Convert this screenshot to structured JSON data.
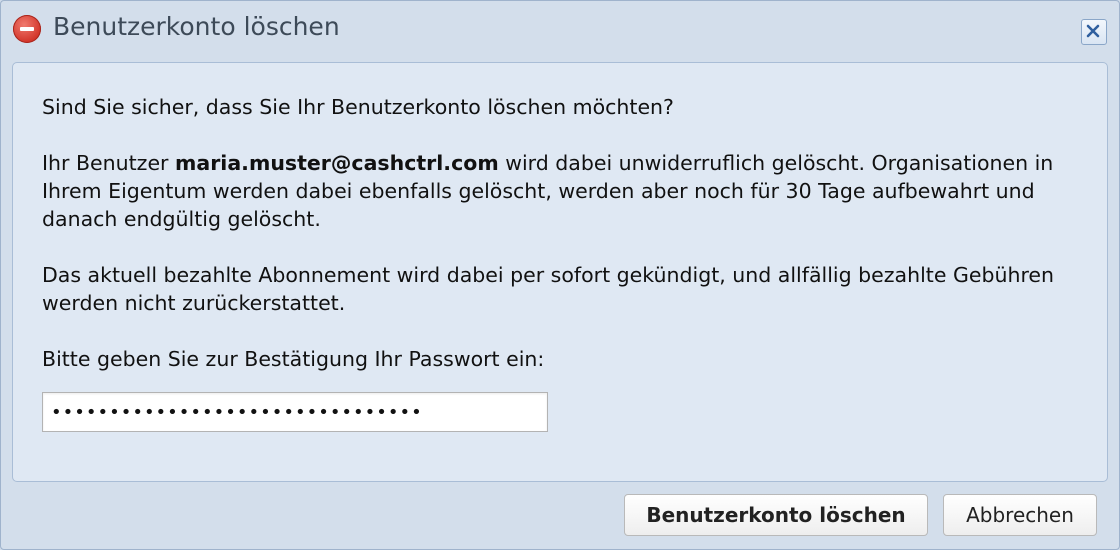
{
  "dialog": {
    "title": "Benutzerkonto löschen",
    "title_icon": "stop-icon",
    "close_icon": "close-icon"
  },
  "message": {
    "question": "Sind Sie sicher, dass Sie Ihr Benutzerkonto löschen möchten?",
    "user_prefix": "Ihr Benutzer ",
    "user_email": "maria.muster@cashctrl.com",
    "user_suffix": " wird dabei unwiderruflich gelöscht. Organisationen in Ihrem Eigentum werden dabei ebenfalls gelöscht, werden aber noch für 30 Tage aufbewahrt und danach endgültig gelöscht.",
    "subscription": "Das aktuell bezahlte Abonnement wird dabei per sofort gekündigt, und allfällig bezahlte Gebühren werden nicht zurückerstattet.",
    "password_prompt": "Bitte geben Sie zur Bestätigung Ihr Passwort ein:"
  },
  "password_field": {
    "value": "••••••••••••••••••••••••••••••••"
  },
  "buttons": {
    "delete_label": "Benutzerkonto löschen",
    "cancel_label": "Abbrechen"
  },
  "colors": {
    "background": "#d3deeb",
    "panel": "#dfe8f3",
    "stop_icon": "#d2352a"
  }
}
